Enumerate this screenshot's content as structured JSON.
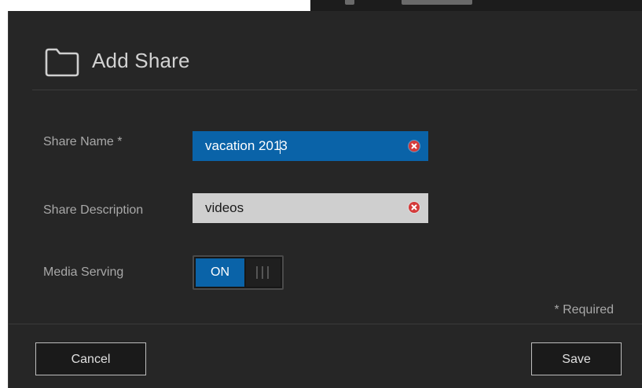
{
  "dialog": {
    "title": "Add Share",
    "title_icon": "folder-icon"
  },
  "form": {
    "share_name": {
      "label": "Share Name *",
      "value_before_cursor": "vacation 201",
      "value_after_cursor": "3",
      "clear_icon": "clear-icon"
    },
    "share_description": {
      "label": "Share Description",
      "value": "videos",
      "clear_icon": "clear-icon"
    },
    "media_serving": {
      "label": "Media Serving",
      "state_label": "ON"
    },
    "required_note": "* Required"
  },
  "footer": {
    "cancel_label": "Cancel",
    "save_label": "Save"
  },
  "colors": {
    "accent": "#0a63a8",
    "dialog_bg": "#262626",
    "clear_icon": "#d43a3a"
  }
}
